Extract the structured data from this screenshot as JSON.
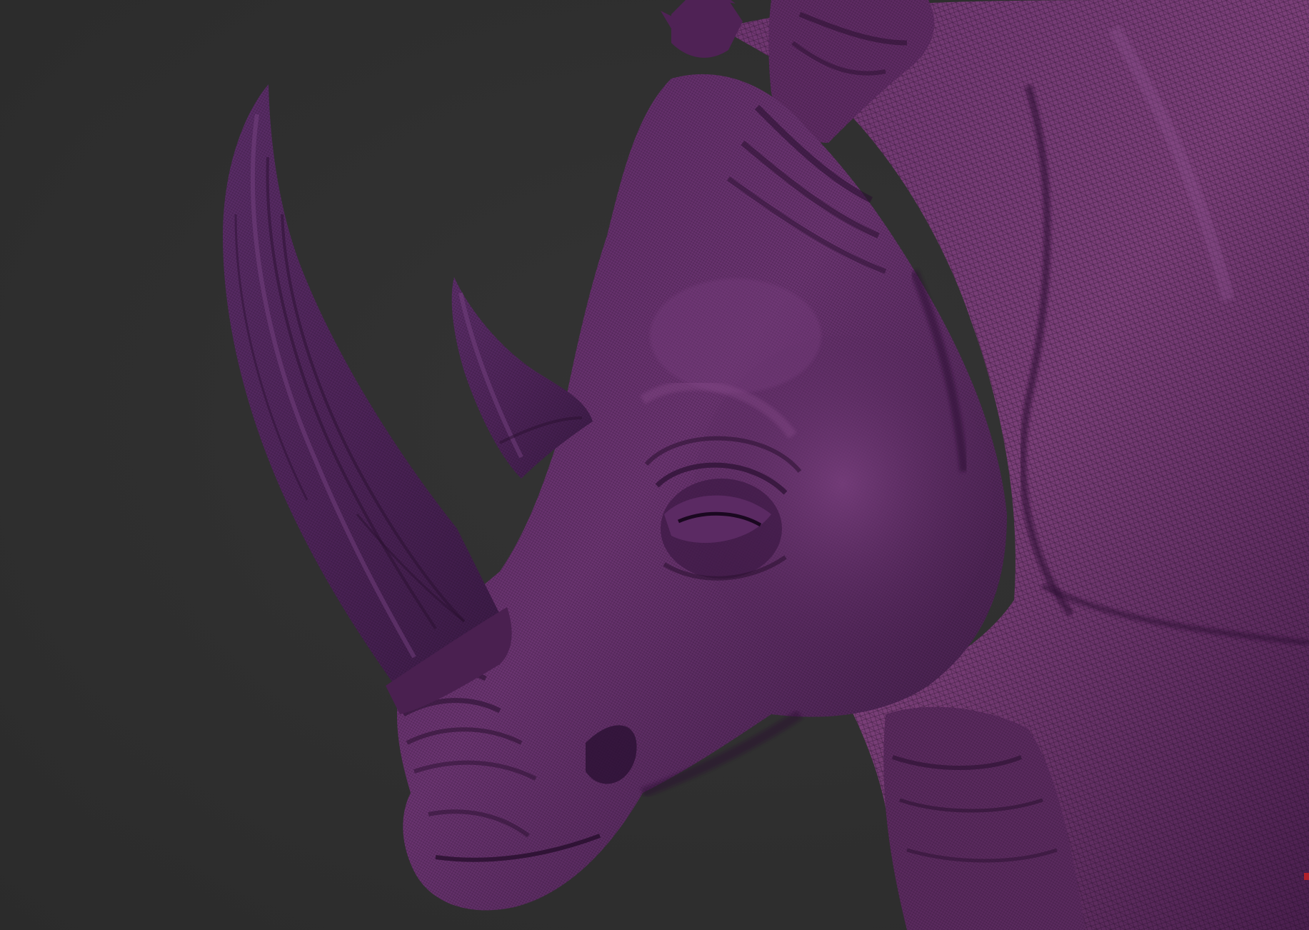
{
  "scene": {
    "subject": "rhino-head-sculpt",
    "background_color": "#2f2f2f",
    "material_base_color": "#5a2a5e",
    "material_highlight_color": "#8a4a88",
    "material_shadow_color": "#2a1030",
    "wireframe_color": "#1c0a1f"
  }
}
